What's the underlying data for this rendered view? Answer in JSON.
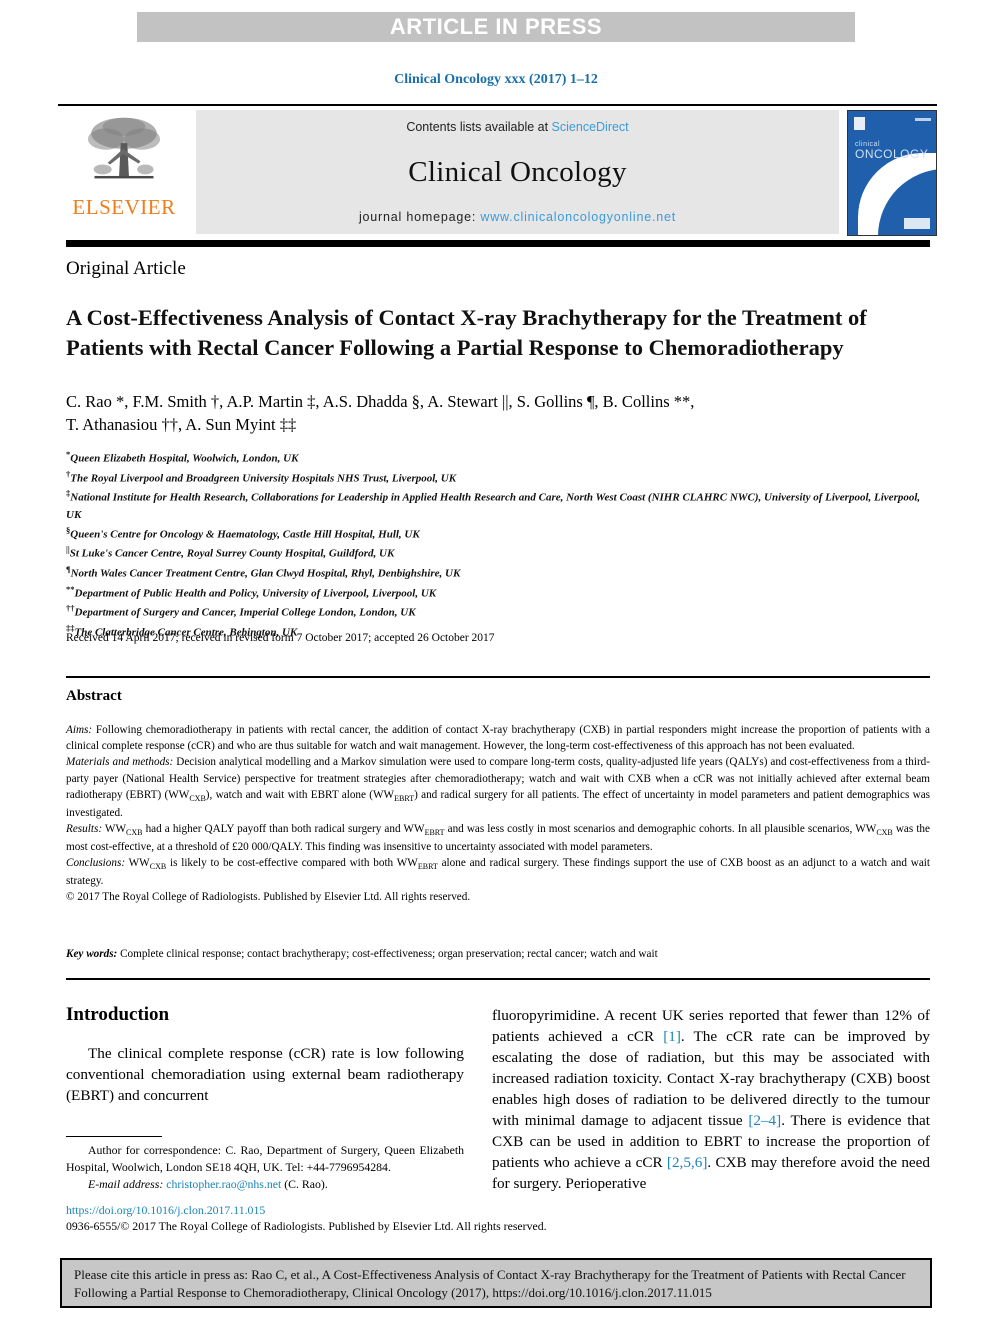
{
  "banner": {
    "text": "ARTICLE IN PRESS"
  },
  "journal_ref": "Clinical Oncology xxx (2017) 1–12",
  "masthead": {
    "publisher": "ELSEVIER",
    "contents_prefix": "Contents lists available at ",
    "contents_link": "ScienceDirect",
    "journal_name": "Clinical Oncology",
    "homepage_prefix": "journal homepage: ",
    "homepage_url": "www.clinicaloncologyonline.net",
    "cover": {
      "line1": "clinical",
      "line2": "ONCOLOGY"
    }
  },
  "article": {
    "type": "Original Article",
    "title": "A Cost-Effectiveness Analysis of Contact X-ray Brachytherapy for the Treatment of Patients with Rectal Cancer Following a Partial Response to Chemoradiotherapy",
    "authors_line1": "C. Rao *, F.M. Smith †, A.P. Martin ‡, A.S. Dhadda §, A. Stewart ||, S. Gollins ¶, B. Collins **,",
    "authors_line2": "T. Athanasiou ††, A. Sun Myint ‡‡",
    "affiliations": [
      {
        "marker": "*",
        "text": "Queen Elizabeth Hospital, Woolwich, London, UK"
      },
      {
        "marker": "†",
        "text": "The Royal Liverpool and Broadgreen University Hospitals NHS Trust, Liverpool, UK"
      },
      {
        "marker": "‡",
        "text": "National Institute for Health Research, Collaborations for Leadership in Applied Health Research and Care, North West Coast (NIHR CLAHRC NWC), University of Liverpool, Liverpool, UK"
      },
      {
        "marker": "§",
        "text": "Queen's Centre for Oncology & Haematology, Castle Hill Hospital, Hull, UK"
      },
      {
        "marker": "||",
        "text": "St Luke's Cancer Centre, Royal Surrey County Hospital, Guildford, UK"
      },
      {
        "marker": "¶",
        "text": "North Wales Cancer Treatment Centre, Glan Clwyd Hospital, Rhyl, Denbighshire, UK"
      },
      {
        "marker": "**",
        "text": "Department of Public Health and Policy, University of Liverpool, Liverpool, UK"
      },
      {
        "marker": "††",
        "text": "Department of Surgery and Cancer, Imperial College London, London, UK"
      },
      {
        "marker": "‡‡",
        "text": "The Clatterbridge Cancer Centre, Bebington, UK"
      }
    ],
    "received": "Received 14 April 2017; received in revised form 7 October 2017; accepted 26 October 2017"
  },
  "abstract": {
    "heading": "Abstract",
    "aims_label": "Aims:",
    "aims_text": " Following chemoradiotherapy in patients with rectal cancer, the addition of contact X-ray brachytherapy (CXB) in partial responders might increase the proportion of patients with a clinical complete response (cCR) and who are thus suitable for watch and wait management. However, the long-term cost-effectiveness of this approach has not been evaluated.",
    "methods_label": "Materials and methods:",
    "methods_text_a": " Decision analytical modelling and a Markov simulation were used to compare long-term costs, quality-adjusted life years (QALYs) and cost-effectiveness from a third-party payer (National Health Service) perspective for treatment strategies after chemoradiotherapy; watch and wait with CXB when a cCR was not initially achieved after external beam radiotherapy (EBRT) (WW",
    "methods_sub_a": "CXB",
    "methods_text_b": "), watch and wait with EBRT alone (WW",
    "methods_sub_b": "EBRT",
    "methods_text_c": ") and radical surgery for all patients. The effect of uncertainty in model parameters and patient demographics was investigated.",
    "results_label": "Results:",
    "results_text_a": " WW",
    "results_sub_a": "CXB",
    "results_text_b": " had a higher QALY payoff than both radical surgery and WW",
    "results_sub_b": "EBRT",
    "results_text_c": " and was less costly in most scenarios and demographic cohorts. In all plausible scenarios, WW",
    "results_sub_c": "CXB",
    "results_text_d": " was the most cost-effective, at a threshold of £20 000/QALY. This finding was insensitive to uncertainty associated with model parameters.",
    "conclusions_label": "Conclusions:",
    "conclusions_text_a": " WW",
    "conclusions_sub_a": "CXB",
    "conclusions_text_b": " is likely to be cost-effective compared with both WW",
    "conclusions_sub_b": "EBRT",
    "conclusions_text_c": " alone and radical surgery. These findings support the use of CXB boost as an adjunct to a watch and wait strategy.",
    "copyright": "© 2017 The Royal College of Radiologists. Published by Elsevier Ltd. All rights reserved."
  },
  "keywords": {
    "label": "Key words:",
    "text": " Complete clinical response; contact brachytherapy; cost-effectiveness; organ preservation; rectal cancer; watch and wait"
  },
  "introduction": {
    "heading": "Introduction",
    "left_para": "The clinical complete response (cCR) rate is low following conventional chemoradiation using external beam radiotherapy (EBRT) and concurrent",
    "right_text_1": "fluoropyrimidine. A recent UK series reported that fewer than 12% of patients achieved a cCR ",
    "right_ref_1": "[1]",
    "right_text_2": ". The cCR rate can be improved by escalating the dose of radiation, but this may be associated with increased radiation toxicity. Contact X-ray brachytherapy (CXB) boost enables high doses of radiation to be delivered directly to the tumour with minimal damage to adjacent tissue ",
    "right_ref_2": "[2–4]",
    "right_text_3": ". There is evidence that CXB can be used in addition to EBRT to increase the proportion of patients who achieve a cCR ",
    "right_ref_3": "[2,5,6]",
    "right_text_4": ". CXB may therefore avoid the need for surgery. Perioperative"
  },
  "footnote": {
    "correspondence": "Author for correspondence: C. Rao, Department of Surgery, Queen Elizabeth Hospital, Woolwich, London SE18 4QH, UK. Tel: +44-7796954284.",
    "email_label": "E-mail address:",
    "email": "christopher.rao@nhs.net",
    "email_suffix": " (C. Rao)."
  },
  "footer": {
    "doi": "https://doi.org/10.1016/j.clon.2017.11.015",
    "issn_copyright": "0936-6555/© 2017 The Royal College of Radiologists. Published by Elsevier Ltd. All rights reserved."
  },
  "cite_box": {
    "text": "Please cite this article in press as: Rao C, et al., A Cost-Effectiveness Analysis of Contact X-ray Brachytherapy for the Treatment of Patients with Rectal Cancer Following a Partial Response to Chemoradiotherapy, Clinical Oncology (2017), https://doi.org/10.1016/j.clon.2017.11.015"
  },
  "colors": {
    "banner_bg": "#c2c2c2",
    "link_blue": "#1a84b8",
    "journal_blue": "#1a6ea8",
    "elsevier_orange": "#ef7d1a",
    "contents_bg": "#e6e6e6",
    "cover_blue": "#1f5fab",
    "cite_bg": "#c7c7c7"
  }
}
